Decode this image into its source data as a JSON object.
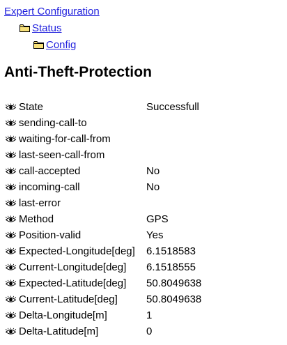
{
  "breadcrumb": {
    "root": "Expert Configuration",
    "level1": "Status",
    "level2": "Config"
  },
  "icons": {
    "folder": "folder-icon",
    "eye": "eye-icon"
  },
  "page_title": "Anti-Theft-Protection",
  "rows": [
    {
      "label": "State",
      "value": "Successfull"
    },
    {
      "label": "sending-call-to",
      "value": ""
    },
    {
      "label": "waiting-for-call-from",
      "value": ""
    },
    {
      "label": "last-seen-call-from",
      "value": ""
    },
    {
      "label": "call-accepted",
      "value": "No"
    },
    {
      "label": "incoming-call",
      "value": "No"
    },
    {
      "label": "last-error",
      "value": ""
    },
    {
      "label": "Method",
      "value": "GPS"
    },
    {
      "label": "Position-valid",
      "value": "Yes"
    },
    {
      "label": "Expected-Longitude[deg]",
      "value": "6.1518583"
    },
    {
      "label": "Current-Longitude[deg]",
      "value": "6.1518555"
    },
    {
      "label": "Expected-Latitude[deg]",
      "value": "50.8049638"
    },
    {
      "label": "Current-Latitude[deg]",
      "value": "50.8049638"
    },
    {
      "label": "Delta-Longitude[m]",
      "value": "1"
    },
    {
      "label": "Delta-Latitude[m]",
      "value": "0"
    }
  ]
}
